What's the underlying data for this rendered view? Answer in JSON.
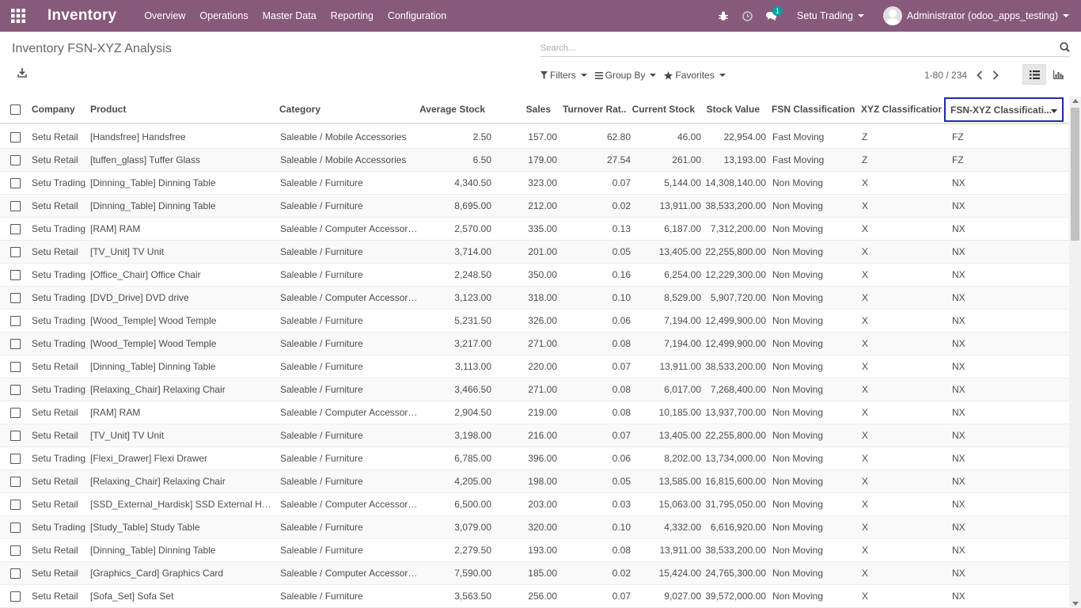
{
  "navbar": {
    "app_title": "Inventory",
    "menu": [
      "Overview",
      "Operations",
      "Master Data",
      "Reporting",
      "Configuration"
    ],
    "chat_badge": "1",
    "company": "Setu Trading",
    "user": "Administrator (odoo_apps_testing)",
    "bg_color": "#875a7b"
  },
  "control": {
    "title": "Inventory FSN-XYZ Analysis",
    "search_placeholder": "Search...",
    "filters_label": "Filters",
    "groupby_label": "Group By",
    "favorites_label": "Favorites",
    "pager": "1-80 / 234"
  },
  "table": {
    "columns": [
      "Company",
      "Product",
      "Category",
      "Average Stock",
      "Sales",
      "Turnover Rat...",
      "Current Stock",
      "Stock Value",
      "FSN Classification",
      "XYZ Classification",
      "FSN-XYZ Classificati..."
    ],
    "rows": [
      [
        "Setu Retail",
        "[Handsfree] Handsfree",
        "Saleable / Mobile Accessories",
        "2.50",
        "157.00",
        "62.80",
        "46.00",
        "22,954.00",
        "Fast Moving",
        "Z",
        "FZ"
      ],
      [
        "Setu Retail",
        "[tuffen_glass] Tuffer Glass",
        "Saleable / Mobile Accessories",
        "6.50",
        "179.00",
        "27.54",
        "261.00",
        "13,193.00",
        "Fast Moving",
        "Z",
        "FZ"
      ],
      [
        "Setu Trading",
        "[Dinning_Table] Dinning Table",
        "Saleable / Furniture",
        "4,340.50",
        "323.00",
        "0.07",
        "5,144.00",
        "14,308,140.00",
        "Non Moving",
        "X",
        "NX"
      ],
      [
        "Setu Retail",
        "[Dinning_Table] Dinning Table",
        "Saleable / Furniture",
        "8,695.00",
        "212.00",
        "0.02",
        "13,911.00",
        "38,533,200.00",
        "Non Moving",
        "X",
        "NX"
      ],
      [
        "Setu Trading",
        "[RAM] RAM",
        "Saleable / Computer Accessories",
        "2,570.00",
        "335.00",
        "0.13",
        "6,187.00",
        "7,312,200.00",
        "Non Moving",
        "X",
        "NX"
      ],
      [
        "Setu Retail",
        "[TV_Unit] TV Unit",
        "Saleable / Furniture",
        "3,714.00",
        "201.00",
        "0.05",
        "13,405.00",
        "22,255,800.00",
        "Non Moving",
        "X",
        "NX"
      ],
      [
        "Setu Trading",
        "[Office_Chair] Office Chair",
        "Saleable / Furniture",
        "2,248.50",
        "350.00",
        "0.16",
        "6,254.00",
        "12,229,300.00",
        "Non Moving",
        "X",
        "NX"
      ],
      [
        "Setu Trading",
        "[DVD_Drive] DVD drive",
        "Saleable / Computer Accessories",
        "3,123.00",
        "318.00",
        "0.10",
        "8,529.00",
        "5,907,720.00",
        "Non Moving",
        "X",
        "NX"
      ],
      [
        "Setu Trading",
        "[Wood_Temple] Wood Temple",
        "Saleable / Furniture",
        "5,231.50",
        "326.00",
        "0.06",
        "7,194.00",
        "12,499,900.00",
        "Non Moving",
        "X",
        "NX"
      ],
      [
        "Setu Trading",
        "[Wood_Temple] Wood Temple",
        "Saleable / Furniture",
        "3,217.00",
        "271.00",
        "0.08",
        "7,194.00",
        "12,499,900.00",
        "Non Moving",
        "X",
        "NX"
      ],
      [
        "Setu Retail",
        "[Dinning_Table] Dinning Table",
        "Saleable / Furniture",
        "3,113.00",
        "220.00",
        "0.07",
        "13,911.00",
        "38,533,200.00",
        "Non Moving",
        "X",
        "NX"
      ],
      [
        "Setu Trading",
        "[Relaxing_Chair] Relaxing Chair",
        "Saleable / Furniture",
        "3,466.50",
        "271.00",
        "0.08",
        "6,017.00",
        "7,268,400.00",
        "Non Moving",
        "X",
        "NX"
      ],
      [
        "Setu Retail",
        "[RAM] RAM",
        "Saleable / Computer Accessories",
        "2,904.50",
        "219.00",
        "0.08",
        "10,185.00",
        "13,937,700.00",
        "Non Moving",
        "X",
        "NX"
      ],
      [
        "Setu Retail",
        "[TV_Unit] TV Unit",
        "Saleable / Furniture",
        "3,198.00",
        "216.00",
        "0.07",
        "13,405.00",
        "22,255,800.00",
        "Non Moving",
        "X",
        "NX"
      ],
      [
        "Setu Trading",
        "[Flexi_Drawer] Flexi Drawer",
        "Saleable / Furniture",
        "6,785.00",
        "396.00",
        "0.06",
        "8,202.00",
        "13,734,000.00",
        "Non Moving",
        "X",
        "NX"
      ],
      [
        "Setu Retail",
        "[Relaxing_Chair] Relaxing Chair",
        "Saleable / Furniture",
        "4,205.00",
        "198.00",
        "0.05",
        "13,585.00",
        "16,815,600.00",
        "Non Moving",
        "X",
        "NX"
      ],
      [
        "Setu Retail",
        "[SSD_External_Hardisk] SSD External Hardi...",
        "Saleable / Computer Accessories",
        "6,500.00",
        "203.00",
        "0.03",
        "15,063.00",
        "31,795,050.00",
        "Non Moving",
        "X",
        "NX"
      ],
      [
        "Setu Trading",
        "[Study_Table] Study Table",
        "Saleable / Furniture",
        "3,079.00",
        "320.00",
        "0.10",
        "4,332.00",
        "6,616,920.00",
        "Non Moving",
        "X",
        "NX"
      ],
      [
        "Setu Retail",
        "[Dinning_Table] Dinning Table",
        "Saleable / Furniture",
        "2,279.50",
        "193.00",
        "0.08",
        "13,911.00",
        "38,533,200.00",
        "Non Moving",
        "X",
        "NX"
      ],
      [
        "Setu Retail",
        "[Graphics_Card] Graphics Card",
        "Saleable / Computer Accessories",
        "7,590.00",
        "185.00",
        "0.02",
        "15,424.00",
        "24,765,300.00",
        "Non Moving",
        "X",
        "NX"
      ],
      [
        "Setu Retail",
        "[Sofa_Set] Sofa Set",
        "Saleable / Furniture",
        "3,563.50",
        "256.00",
        "0.07",
        "9,027.00",
        "39,572,000.00",
        "Non Moving",
        "X",
        "NX"
      ]
    ]
  }
}
